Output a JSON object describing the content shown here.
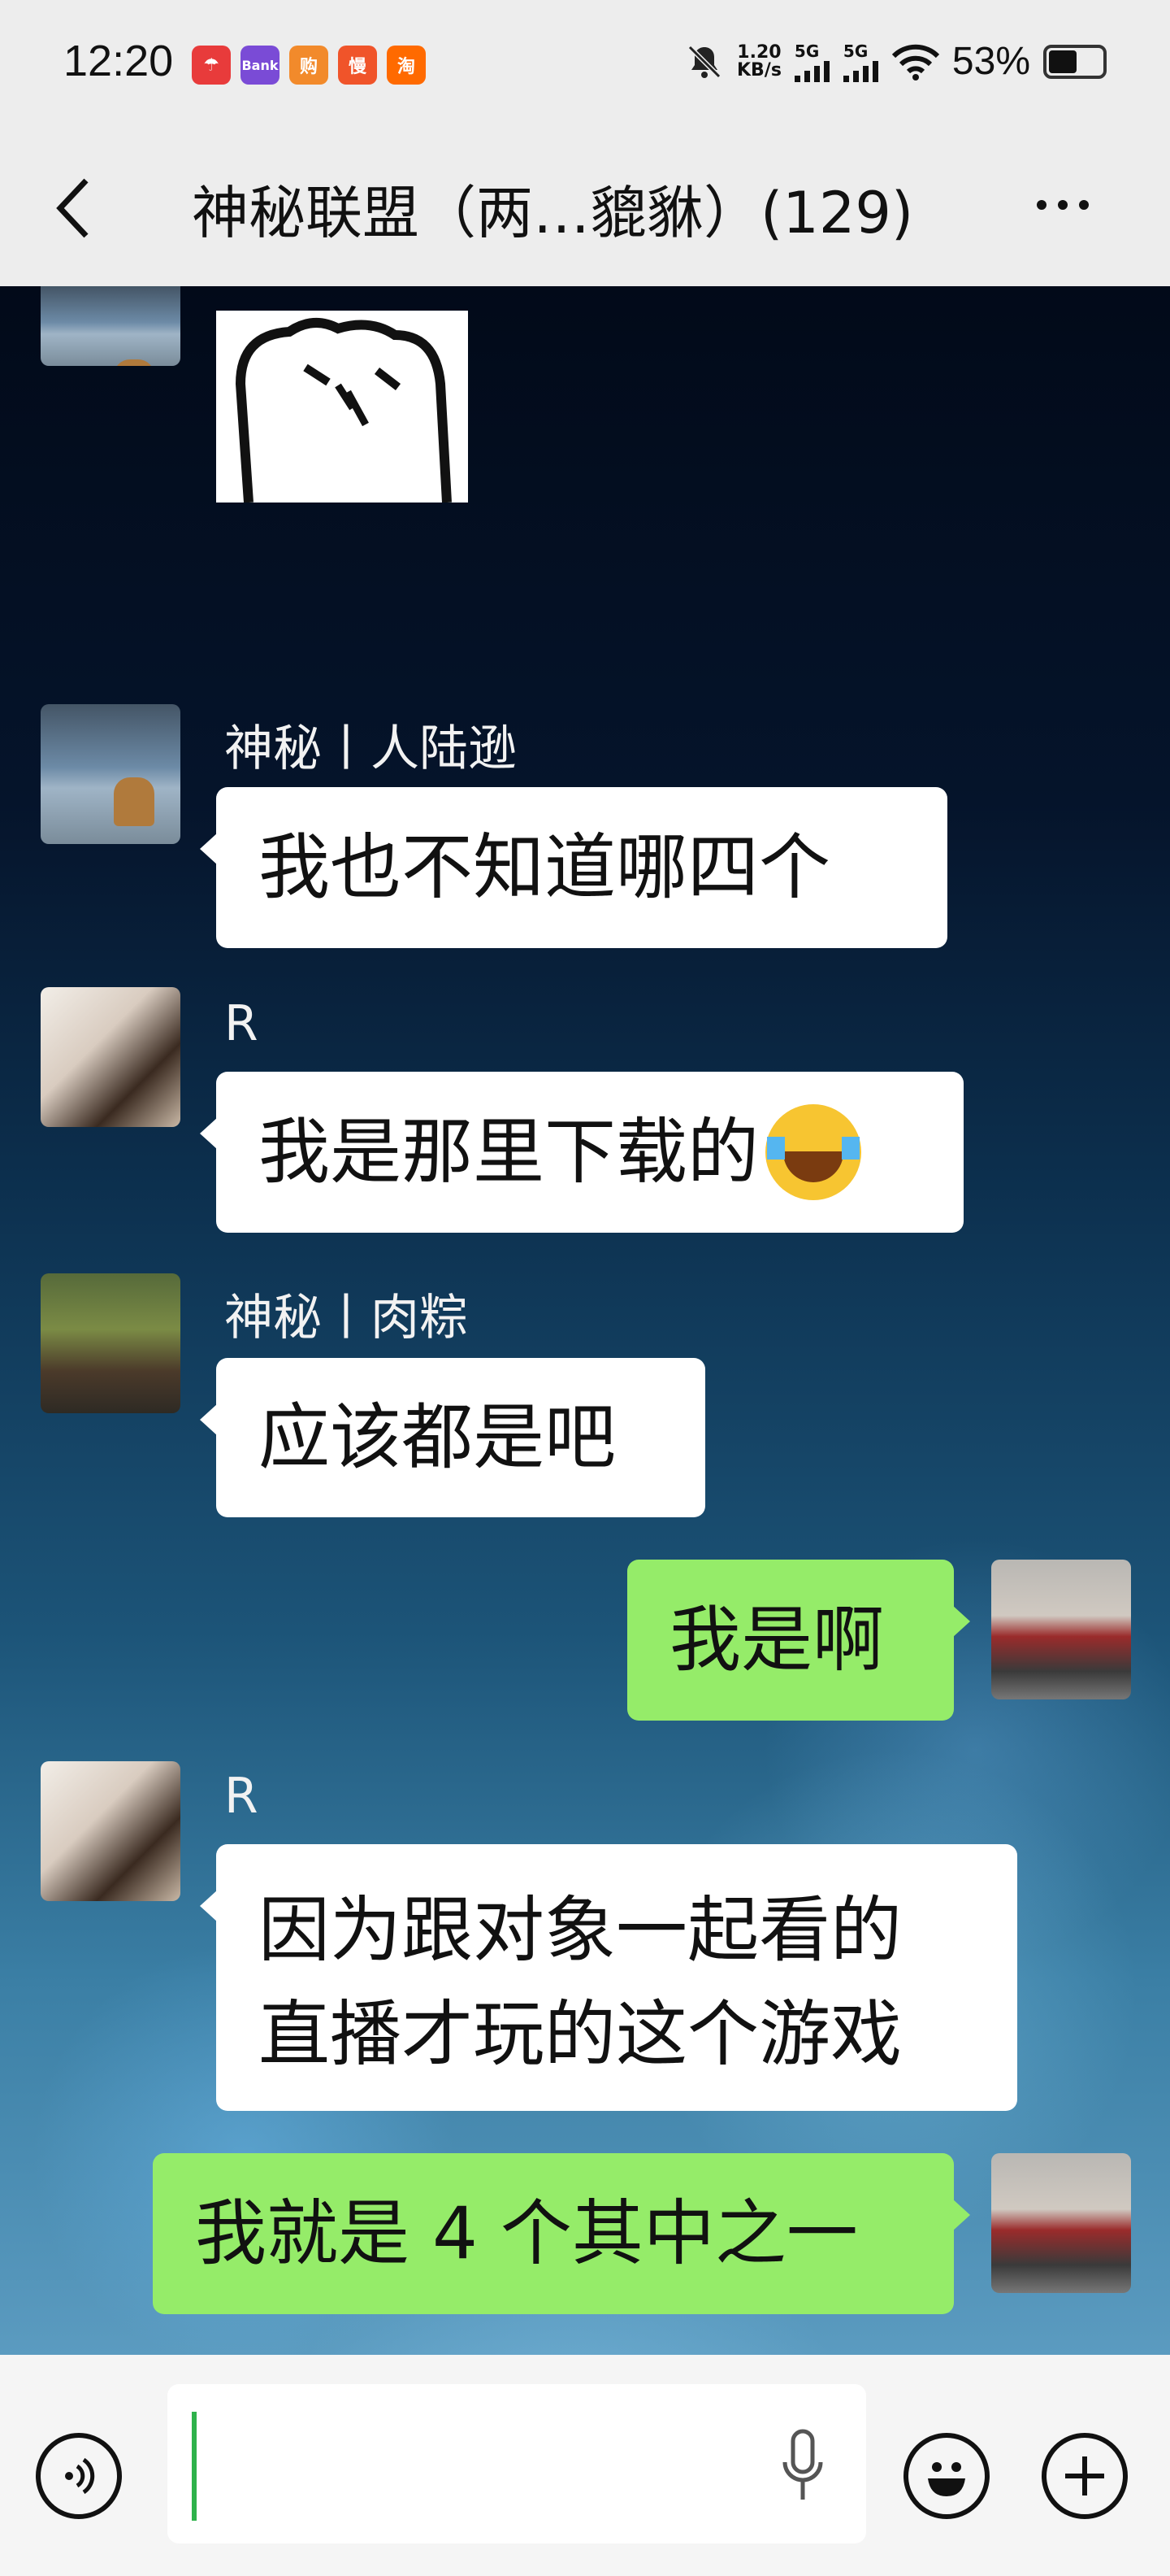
{
  "status_bar": {
    "time": "12:20",
    "app_badges": [
      {
        "label": "☂",
        "color": "#e83b3b"
      },
      {
        "label": "Bank",
        "color": "#7a4bd6"
      },
      {
        "label": "购",
        "color": "#f28a2b"
      },
      {
        "label": "慢",
        "color": "#f0542a"
      },
      {
        "label": "淘",
        "color": "#ff6a00"
      }
    ],
    "net_speed_value": "1.20",
    "net_speed_unit": "KB/s",
    "signal_1": "5G",
    "signal_2": "5G",
    "battery_percent": "53%",
    "battery_level": 0.53
  },
  "header": {
    "title": "神秘联盟（两…貔貅）(129)"
  },
  "chat": {
    "messages": [
      {
        "sender": "神秘丨人陆逊",
        "text": "我也不知道哪四个",
        "direction": "in"
      },
      {
        "sender": "R",
        "text": "我是那里下载的",
        "emoji": "laughing-tears",
        "direction": "in"
      },
      {
        "sender": "神秘丨肉粽",
        "text": "应该都是吧",
        "direction": "in"
      },
      {
        "sender": "",
        "text": "我是啊",
        "direction": "out"
      },
      {
        "sender": "R",
        "text_line1": "因为跟对象一起看的",
        "text_line2": "直播才玩的这个游戏",
        "direction": "in"
      },
      {
        "sender": "",
        "text": "我就是 4 个其中之一",
        "direction": "out"
      }
    ]
  },
  "input_bar": {
    "voice_icon": "voice-icon",
    "mic_icon": "mic-icon",
    "emoji_icon": "emoji-icon",
    "plus_icon": "plus-icon"
  },
  "colors": {
    "outgoing_bubble": "#95ec69",
    "incoming_bubble": "#ffffff",
    "caret": "#2eb24b"
  }
}
